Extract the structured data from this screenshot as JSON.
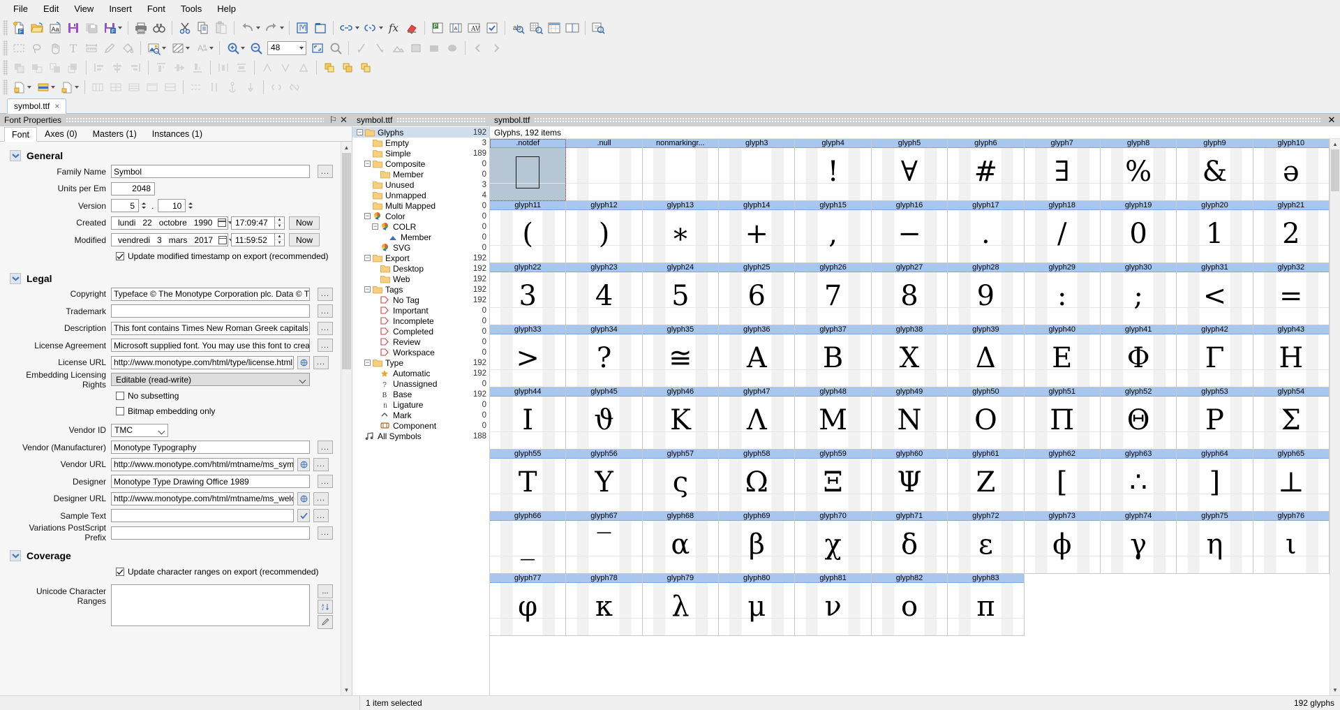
{
  "menu": {
    "items": [
      "File",
      "Edit",
      "View",
      "Insert",
      "Font",
      "Tools",
      "Help"
    ]
  },
  "toolbars": {
    "row1": [
      {
        "name": "new-font-button",
        "icon": "new-doc"
      },
      {
        "name": "open-font-button",
        "icon": "open-folder"
      },
      {
        "name": "open-installed-font-button",
        "icon": "aa-doc"
      },
      {
        "name": "save-button",
        "icon": "floppy-purple"
      },
      {
        "name": "save-all-button",
        "icon": "floppy-grey"
      },
      {
        "name": "export-font-button",
        "icon": "floppy-export"
      },
      {
        "name": "print-button",
        "icon": "printer"
      },
      {
        "name": "find-button",
        "icon": "binoculars"
      },
      {
        "name": "cut-button",
        "icon": "scissors"
      },
      {
        "name": "copy-button",
        "icon": "copy"
      },
      {
        "name": "paste-button",
        "icon": "paste"
      },
      {
        "name": "undo-button",
        "icon": "undo"
      },
      {
        "name": "redo-button",
        "icon": "redo"
      },
      {
        "name": "new-glyph-window-button",
        "icon": "glyph-win"
      },
      {
        "name": "new-glyph-tab-button",
        "icon": "glyph-tab"
      },
      {
        "name": "link-metrics-button",
        "icon": "link"
      },
      {
        "name": "link-kerning-button",
        "icon": "link2"
      },
      {
        "name": "expression-button",
        "icon": "fx"
      },
      {
        "name": "eraser-button",
        "icon": "eraser"
      },
      {
        "name": "preview-panel-button",
        "icon": "p-panel"
      },
      {
        "name": "metrics-window-button",
        "icon": "metrics-win"
      },
      {
        "name": "kerning-window-button",
        "icon": "kerning-win"
      },
      {
        "name": "audit-button",
        "icon": "check-box"
      },
      {
        "name": "font-info-button",
        "icon": "abc-find"
      },
      {
        "name": "font-map-button",
        "icon": "grid-find"
      },
      {
        "name": "font-window-button",
        "icon": "font-win"
      },
      {
        "name": "compare-fonts-button",
        "icon": "compare"
      },
      {
        "name": "quick-help-button",
        "icon": "help-find"
      }
    ],
    "row2": [
      {
        "name": "marquee-tool",
        "icon": "marquee"
      },
      {
        "name": "lasso-tool",
        "icon": "lasso"
      },
      {
        "name": "hand-tool",
        "icon": "hand"
      },
      {
        "name": "text-tool",
        "icon": "text-T"
      },
      {
        "name": "measure-tool",
        "icon": "ruler"
      },
      {
        "name": "pencil-tool",
        "icon": "pencil"
      },
      {
        "name": "paint-bucket-tool",
        "icon": "bucket"
      },
      {
        "name": "image-tool",
        "icon": "image"
      },
      {
        "name": "fill-tool",
        "icon": "hatch"
      },
      {
        "name": "font-audit-tool",
        "icon": "a-dots"
      },
      {
        "name": "zoom-in-button",
        "icon": "zoom-in"
      },
      {
        "name": "zoom-out-button",
        "icon": "zoom-out"
      },
      {
        "name": "fit-button",
        "icon": "fit"
      },
      {
        "name": "zoom-find-button",
        "icon": "zoom-find"
      },
      {
        "name": "skew-left-tool",
        "icon": "skew-l"
      },
      {
        "name": "skew-right-tool",
        "icon": "skew-r"
      },
      {
        "name": "picture-tool",
        "icon": "picture"
      },
      {
        "name": "gradient-tool",
        "icon": "gradient"
      },
      {
        "name": "rect-tool",
        "icon": "rect"
      },
      {
        "name": "ellipse-tool",
        "icon": "ellipse"
      },
      {
        "name": "back-button",
        "icon": "left-arrow"
      },
      {
        "name": "forward-button",
        "icon": "right-arrow"
      }
    ],
    "zoom_value": "48"
  },
  "document_tab": {
    "label": "symbol.ttf",
    "close": "×"
  },
  "properties_panel": {
    "caption": "Font Properties",
    "pin_icon": "⚐",
    "close_icon": "✕",
    "tabs": [
      {
        "label": "Font",
        "active": true
      },
      {
        "label": "Axes (0)",
        "active": false
      },
      {
        "label": "Masters (1)",
        "active": false
      },
      {
        "label": "Instances (1)",
        "active": false
      }
    ],
    "sections": {
      "general": {
        "title": "General",
        "family_name": {
          "label": "Family Name",
          "value": "Symbol"
        },
        "units_per_em": {
          "label": "Units per Em",
          "value": "2048"
        },
        "version": {
          "label": "Version",
          "major": "5",
          "minor": "10",
          "separator": "."
        },
        "created": {
          "label": "Created",
          "weekday": "lundi",
          "day": "22",
          "month": "octobre",
          "year": "1990",
          "time": "17:09:47",
          "now_label": "Now"
        },
        "modified": {
          "label": "Modified",
          "weekday": "vendredi",
          "day": "3",
          "month": "mars",
          "year": "2017",
          "time": "11:59:52",
          "now_label": "Now"
        },
        "update_timestamp": {
          "label": "Update modified timestamp on export (recommended)",
          "checked": true
        }
      },
      "legal": {
        "title": "Legal",
        "copyright": {
          "label": "Copyright",
          "value": "Typeface © The Monotype Corporation plc. Data © The Monotyp"
        },
        "trademark": {
          "label": "Trademark",
          "value": ""
        },
        "description": {
          "label": "Description",
          "value": "This font contains Times New Roman Greek capitals and lowercas"
        },
        "license_agreement": {
          "label": "License Agreement",
          "value": "Microsoft supplied font. You may use this font to create, display, a"
        },
        "license_url": {
          "label": "License URL",
          "value": "http://www.monotype.com/html/type/license.html"
        },
        "embedding_rights": {
          "label": "Embedding Licensing Rights",
          "value": "Editable (read-write)"
        },
        "no_subsetting": {
          "label": "No subsetting",
          "checked": false
        },
        "bitmap_embedding_only": {
          "label": "Bitmap embedding only",
          "checked": false
        },
        "vendor_id": {
          "label": "Vendor ID",
          "value": "TMC"
        },
        "vendor_manufacturer": {
          "label": "Vendor (Manufacturer)",
          "value": "Monotype Typography"
        },
        "vendor_url": {
          "label": "Vendor URL",
          "value": "http://www.monotype.com/html/mtname/ms_symbol.htm"
        },
        "designer": {
          "label": "Designer",
          "value": "Monotype Type Drawing Office 1989"
        },
        "designer_url": {
          "label": "Designer URL",
          "value": "http://www.monotype.com/html/mtname/ms_welcome.ht"
        },
        "sample_text": {
          "label": "Sample Text",
          "value": ""
        },
        "variations_postscript_prefix": {
          "label": "Variations PostScript Prefix",
          "value": ""
        }
      },
      "coverage": {
        "title": "Coverage",
        "update_char_ranges": {
          "label": "Update character ranges on export (recommended)",
          "checked": true
        },
        "unicode_character_ranges": {
          "label": "Unicode Character Ranges",
          "value": ""
        }
      }
    },
    "ellipsis_label": "..."
  },
  "tree_panel": {
    "caption": "symbol.ttf",
    "nodes": [
      {
        "label": "Glyphs",
        "count": "192",
        "depth": 0,
        "icon": "folder",
        "expander": "minus",
        "selected": true
      },
      {
        "label": "Empty",
        "count": "3",
        "depth": 1,
        "icon": "folder",
        "expander": "none"
      },
      {
        "label": "Simple",
        "count": "189",
        "depth": 1,
        "icon": "folder",
        "expander": "none"
      },
      {
        "label": "Composite",
        "count": "0",
        "depth": 1,
        "icon": "folder",
        "expander": "minus"
      },
      {
        "label": "Member",
        "count": "0",
        "depth": 2,
        "icon": "folder",
        "expander": "none"
      },
      {
        "label": "Unused",
        "count": "3",
        "depth": 1,
        "icon": "folder",
        "expander": "none"
      },
      {
        "label": "Unmapped",
        "count": "4",
        "depth": 1,
        "icon": "folder",
        "expander": "none"
      },
      {
        "label": "Multi Mapped",
        "count": "0",
        "depth": 1,
        "icon": "folder",
        "expander": "none"
      },
      {
        "label": "Color",
        "count": "0",
        "depth": 1,
        "icon": "color",
        "expander": "minus"
      },
      {
        "label": "COLR",
        "count": "0",
        "depth": 2,
        "icon": "color",
        "expander": "minus"
      },
      {
        "label": "Member",
        "count": "0",
        "depth": 3,
        "icon": "member",
        "expander": "none"
      },
      {
        "label": "SVG",
        "count": "0",
        "depth": 2,
        "icon": "color",
        "expander": "none"
      },
      {
        "label": "Export",
        "count": "192",
        "depth": 1,
        "icon": "folder",
        "expander": "minus"
      },
      {
        "label": "Desktop",
        "count": "192",
        "depth": 2,
        "icon": "folder",
        "expander": "none"
      },
      {
        "label": "Web",
        "count": "192",
        "depth": 2,
        "icon": "folder",
        "expander": "none"
      },
      {
        "label": "Tags",
        "count": "192",
        "depth": 1,
        "icon": "folder",
        "expander": "minus"
      },
      {
        "label": "No Tag",
        "count": "192",
        "depth": 2,
        "icon": "tag",
        "expander": "none"
      },
      {
        "label": "Important",
        "count": "0",
        "depth": 2,
        "icon": "tag",
        "expander": "none"
      },
      {
        "label": "Incomplete",
        "count": "0",
        "depth": 2,
        "icon": "tag",
        "expander": "none"
      },
      {
        "label": "Completed",
        "count": "0",
        "depth": 2,
        "icon": "tag",
        "expander": "none"
      },
      {
        "label": "Review",
        "count": "0",
        "depth": 2,
        "icon": "tag",
        "expander": "none"
      },
      {
        "label": "Workspace",
        "count": "0",
        "depth": 2,
        "icon": "tag",
        "expander": "none"
      },
      {
        "label": "Type",
        "count": "192",
        "depth": 1,
        "icon": "folder",
        "expander": "minus"
      },
      {
        "label": "Automatic",
        "count": "192",
        "depth": 2,
        "icon": "auto",
        "expander": "none"
      },
      {
        "label": "Unassigned",
        "count": "0",
        "depth": 2,
        "icon": "question",
        "expander": "none"
      },
      {
        "label": "Base",
        "count": "192",
        "depth": 2,
        "icon": "base-b",
        "expander": "none"
      },
      {
        "label": "Ligature",
        "count": "0",
        "depth": 2,
        "icon": "ligature",
        "expander": "none"
      },
      {
        "label": "Mark",
        "count": "0",
        "depth": 2,
        "icon": "mark",
        "expander": "none"
      },
      {
        "label": "Component",
        "count": "0",
        "depth": 2,
        "icon": "component",
        "expander": "none"
      },
      {
        "label": "All Symbols",
        "count": "188",
        "depth": 0,
        "icon": "symbols",
        "expander": "none"
      }
    ]
  },
  "glyph_grid": {
    "caption": "symbol.ttf",
    "close_icon": "✕",
    "info": "Glyphs, 192 items",
    "columns": 11,
    "cells": [
      {
        "name": ".notdef",
        "glyph": "",
        "selected": true,
        "box": true
      },
      {
        "name": ".null",
        "glyph": ""
      },
      {
        "name": "nonmarkingr...",
        "glyph": ""
      },
      {
        "name": "glyph3",
        "glyph": ""
      },
      {
        "name": "glyph4",
        "glyph": "!"
      },
      {
        "name": "glyph5",
        "glyph": "∀"
      },
      {
        "name": "glyph6",
        "glyph": "#"
      },
      {
        "name": "glyph7",
        "glyph": "∃"
      },
      {
        "name": "glyph8",
        "glyph": "%"
      },
      {
        "name": "glyph9",
        "glyph": "&"
      },
      {
        "name": "glyph10",
        "glyph": "ə"
      },
      {
        "name": "glyph11",
        "glyph": "("
      },
      {
        "name": "glyph12",
        "glyph": ")"
      },
      {
        "name": "glyph13",
        "glyph": "∗"
      },
      {
        "name": "glyph14",
        "glyph": "+"
      },
      {
        "name": "glyph15",
        "glyph": ","
      },
      {
        "name": "glyph16",
        "glyph": "−"
      },
      {
        "name": "glyph17",
        "glyph": "."
      },
      {
        "name": "glyph18",
        "glyph": "/"
      },
      {
        "name": "glyph19",
        "glyph": "0"
      },
      {
        "name": "glyph20",
        "glyph": "1"
      },
      {
        "name": "glyph21",
        "glyph": "2"
      },
      {
        "name": "glyph22",
        "glyph": "3"
      },
      {
        "name": "glyph23",
        "glyph": "4"
      },
      {
        "name": "glyph24",
        "glyph": "5"
      },
      {
        "name": "glyph25",
        "glyph": "6"
      },
      {
        "name": "glyph26",
        "glyph": "7"
      },
      {
        "name": "glyph27",
        "glyph": "8"
      },
      {
        "name": "glyph28",
        "glyph": "9"
      },
      {
        "name": "glyph29",
        "glyph": ":"
      },
      {
        "name": "glyph30",
        "glyph": ";"
      },
      {
        "name": "glyph31",
        "glyph": "<"
      },
      {
        "name": "glyph32",
        "glyph": "="
      },
      {
        "name": "glyph33",
        "glyph": ">"
      },
      {
        "name": "glyph34",
        "glyph": "?"
      },
      {
        "name": "glyph35",
        "glyph": "≅"
      },
      {
        "name": "glyph36",
        "glyph": "Α"
      },
      {
        "name": "glyph37",
        "glyph": "Β"
      },
      {
        "name": "glyph38",
        "glyph": "Χ"
      },
      {
        "name": "glyph39",
        "glyph": "Δ"
      },
      {
        "name": "glyph40",
        "glyph": "Ε"
      },
      {
        "name": "glyph41",
        "glyph": "Φ"
      },
      {
        "name": "glyph42",
        "glyph": "Γ"
      },
      {
        "name": "glyph43",
        "glyph": "Η"
      },
      {
        "name": "glyph44",
        "glyph": "Ι"
      },
      {
        "name": "glyph45",
        "glyph": "ϑ"
      },
      {
        "name": "glyph46",
        "glyph": "Κ"
      },
      {
        "name": "glyph47",
        "glyph": "Λ"
      },
      {
        "name": "glyph48",
        "glyph": "Μ"
      },
      {
        "name": "glyph49",
        "glyph": "Ν"
      },
      {
        "name": "glyph50",
        "glyph": "Ο"
      },
      {
        "name": "glyph51",
        "glyph": "Π"
      },
      {
        "name": "glyph52",
        "glyph": "Θ"
      },
      {
        "name": "glyph53",
        "glyph": "Ρ"
      },
      {
        "name": "glyph54",
        "glyph": "Σ"
      },
      {
        "name": "glyph55",
        "glyph": "Τ"
      },
      {
        "name": "glyph56",
        "glyph": "Υ"
      },
      {
        "name": "glyph57",
        "glyph": "ς"
      },
      {
        "name": "glyph58",
        "glyph": "Ω"
      },
      {
        "name": "glyph59",
        "glyph": "Ξ"
      },
      {
        "name": "glyph60",
        "glyph": "Ψ"
      },
      {
        "name": "glyph61",
        "glyph": "Ζ"
      },
      {
        "name": "glyph62",
        "glyph": "["
      },
      {
        "name": "glyph63",
        "glyph": "∴"
      },
      {
        "name": "glyph64",
        "glyph": "]"
      },
      {
        "name": "glyph65",
        "glyph": "⊥"
      },
      {
        "name": "glyph66",
        "glyph": "_"
      },
      {
        "name": "glyph67",
        "glyph": "‾"
      },
      {
        "name": "glyph68",
        "glyph": "α"
      },
      {
        "name": "glyph69",
        "glyph": "β"
      },
      {
        "name": "glyph70",
        "glyph": "χ"
      },
      {
        "name": "glyph71",
        "glyph": "δ"
      },
      {
        "name": "glyph72",
        "glyph": "ε"
      },
      {
        "name": "glyph73",
        "glyph": "ϕ"
      },
      {
        "name": "glyph74",
        "glyph": "γ"
      },
      {
        "name": "glyph75",
        "glyph": "η"
      },
      {
        "name": "glyph76",
        "glyph": "ι"
      },
      {
        "name": "glyph77",
        "glyph": "φ"
      },
      {
        "name": "glyph78",
        "glyph": "κ"
      },
      {
        "name": "glyph79",
        "glyph": "λ"
      },
      {
        "name": "glyph80",
        "glyph": "μ"
      },
      {
        "name": "glyph81",
        "glyph": "ν"
      },
      {
        "name": "glyph82",
        "glyph": "ο"
      },
      {
        "name": "glyph83",
        "glyph": "π"
      }
    ]
  },
  "status_bar": {
    "selection": "1 item selected",
    "glyph_count": "192 glyphs"
  },
  "colors": {
    "glyph_header": "#a8c6ee",
    "selection": "#cfdded",
    "panel_caption": "#cfcfcf",
    "chrome": "#f0f0f0"
  }
}
